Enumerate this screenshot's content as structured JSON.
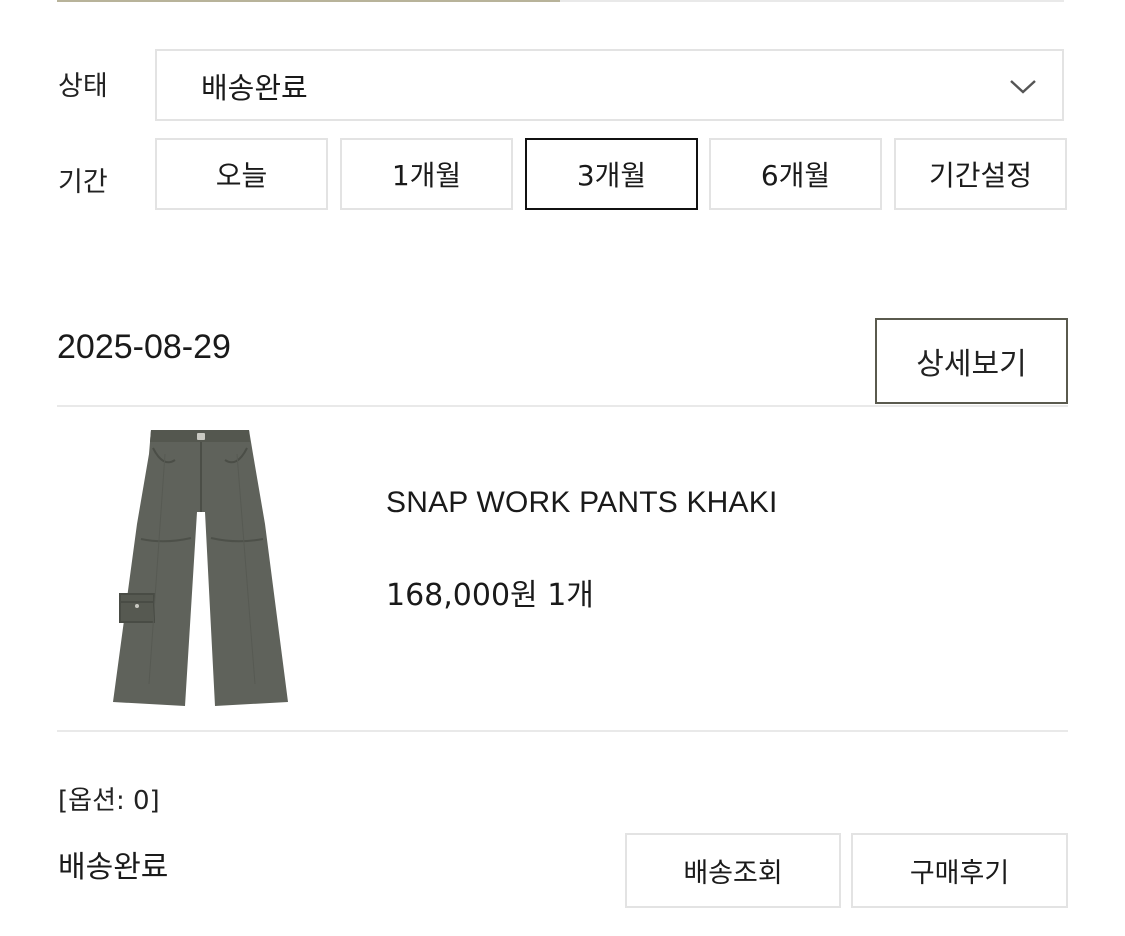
{
  "filter": {
    "status_label": "상태",
    "status_value": "배송완료",
    "period_label": "기간",
    "periods": [
      {
        "label": "오늘",
        "active": false
      },
      {
        "label": "1개월",
        "active": false
      },
      {
        "label": "3개월",
        "active": true
      },
      {
        "label": "6개월",
        "active": false
      },
      {
        "label": "기간설정",
        "active": false
      }
    ]
  },
  "order": {
    "date": "2025-08-29",
    "detail_label": "상세보기",
    "product": {
      "name": "SNAP WORK PANTS KHAKI",
      "price_qty": "168,000원 1개",
      "image_icon": "khaki-work-pants-image"
    },
    "option_text": "[옵션: 0]",
    "status": "배송완료",
    "actions": {
      "tracking_label": "배송조회",
      "review_label": "구매후기"
    }
  },
  "colors": {
    "border": "#e3e3e3",
    "active_border": "#111111",
    "detail_border": "#5a5a4e",
    "pants": "#5f625b"
  }
}
